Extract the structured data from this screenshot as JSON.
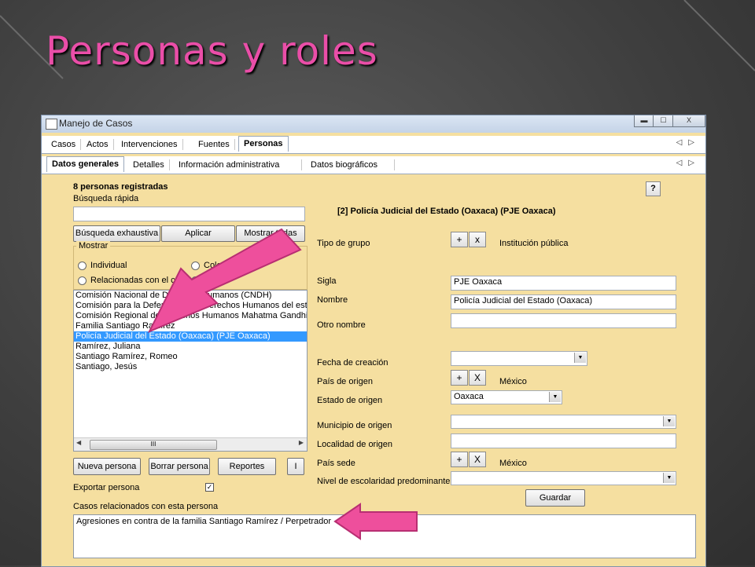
{
  "slide": {
    "title": "Personas y roles"
  },
  "window": {
    "title": "Manejo de Casos",
    "controls": {
      "close": "X"
    }
  },
  "main_tabs": [
    "Casos",
    "Actos",
    "Intervenciones",
    "Fuentes",
    "Personas"
  ],
  "sub_tabs": [
    "Datos generales",
    "Detalles",
    "Información administrativa",
    "Datos biográficos"
  ],
  "left": {
    "count_label": "8 personas registradas",
    "quick_search_label": "Búsqueda rápida",
    "quick_search_value": "",
    "buttons": {
      "exhaustive": "Búsqueda exhaustiva",
      "apply": "Aplicar",
      "show_all": "Mostrar todas"
    },
    "show_group": {
      "legend": "Mostrar",
      "options": [
        {
          "label": "Individual",
          "selected": false
        },
        {
          "label": "Colec",
          "selected": false
        },
        {
          "label": "Relacionadas con el caso",
          "selected": false
        },
        {
          "label": "",
          "selected": true
        }
      ]
    },
    "list": [
      "Comisión Nacional de Derechos Humanos (CNDH)",
      "Comisión para la Defensa de los Derechos Humanos del estado",
      "Comisión Regional de Derechos Humanos Mahatma Gandhi (C",
      "Familia Santiago Ramírez",
      "Policía Judicial del Estado (Oaxaca) (PJE Oaxaca)",
      "Ramírez, Juliana",
      "Santiago Ramírez, Romeo",
      "Santiago, Jesús"
    ],
    "selected_index": 4,
    "scroll_thumb": "III",
    "action_buttons": {
      "new": "Nueva persona",
      "delete": "Borrar persona",
      "reports": "Reportes",
      "info": "I"
    },
    "export_label": "Exportar persona",
    "export_checked": true,
    "related_label": "Casos relacionados con esta persona",
    "related_cases": "Agresiones en contra de la familia Santiago Ramírez / Perpetrador"
  },
  "right": {
    "help": "?",
    "header": "[2] Policía Judicial del Estado (Oaxaca) (PJE Oaxaca)",
    "tipo_grupo_label": "Tipo de grupo",
    "tipo_grupo_value": "Institución pública",
    "plus": "+",
    "x_small": "x",
    "x_cap": "X",
    "sigla_label": "Sigla",
    "sigla_value": "PJE Oaxaca",
    "nombre_label": "Nombre",
    "nombre_value": "Policía Judicial del Estado (Oaxaca)",
    "otro_nombre_label": "Otro nombre",
    "otro_nombre_value": "",
    "fecha_label": "Fecha de creación",
    "pais_origen_label": "País de origen",
    "pais_origen_value": "México",
    "estado_origen_label": "Estado de origen",
    "estado_origen_value": "Oaxaca",
    "municipio_label": "Municipio de origen",
    "localidad_label": "Localidad de origen",
    "pais_sede_label": "País sede",
    "pais_sede_value": "México",
    "escolaridad_label": "Nivel de escolaridad predominante",
    "save": "Guardar"
  },
  "colors": {
    "title_pink": "#ea4ea8",
    "panel": "#f5dfa0",
    "arrow": "#ee4f9c",
    "selection": "#3399ff"
  },
  "icons": [
    "app-icon",
    "minimize-icon",
    "maximize-icon",
    "close-icon",
    "scroll-left-icon",
    "scroll-right-icon",
    "dropdown-arrow-icon",
    "pointer-arrow-icon"
  ]
}
